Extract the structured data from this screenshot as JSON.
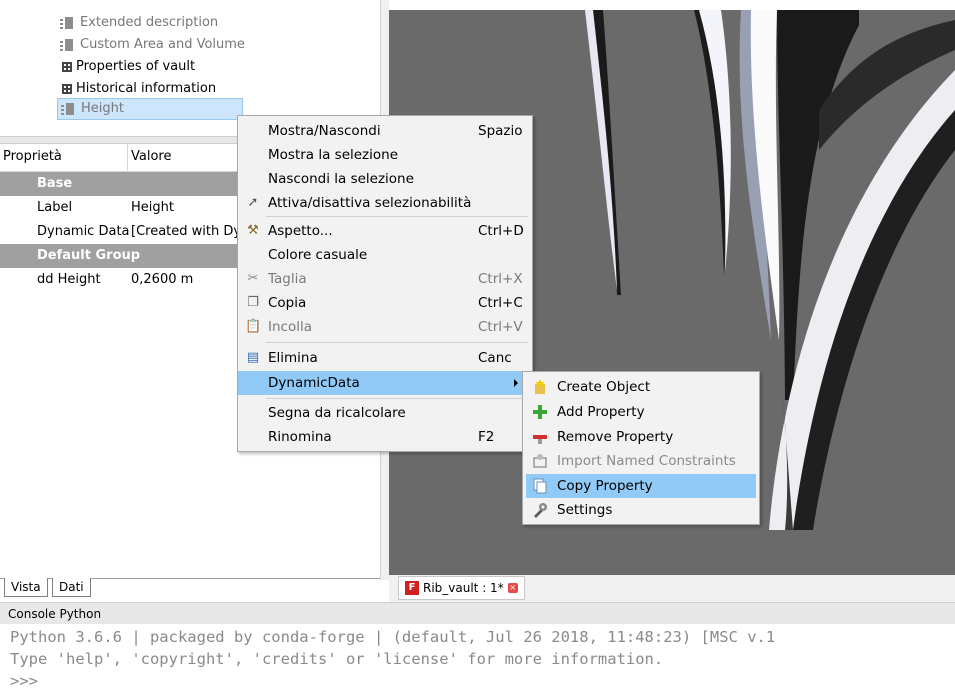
{
  "tree": {
    "items": [
      {
        "label": "Extended description",
        "icon": "document-icon",
        "greyed": true
      },
      {
        "label": "Custom Area and Volume",
        "icon": "document-icon",
        "greyed": true
      },
      {
        "label": "Properties of vault",
        "icon": "table-icon",
        "greyed": false
      },
      {
        "label": "Historical information",
        "icon": "table-icon",
        "greyed": false
      },
      {
        "label": "Height",
        "icon": "document-icon",
        "greyed": true,
        "selected": true
      }
    ]
  },
  "property_table": {
    "headers": [
      "Proprietà",
      "Valore"
    ],
    "rows": [
      {
        "type": "group",
        "name": "Base",
        "value": ""
      },
      {
        "type": "prop",
        "name": "Label",
        "value": "Height"
      },
      {
        "type": "prop",
        "name": "Dynamic Data",
        "value": "[Created with Dy"
      },
      {
        "type": "group",
        "name": "Default Group",
        "value": ""
      },
      {
        "type": "prop",
        "name": "dd Height",
        "value": "0,2600 m"
      }
    ]
  },
  "panel_tabs": [
    "Vista",
    "Dati"
  ],
  "context_menu": {
    "items": [
      {
        "label": "Mostra/Nascondi",
        "shortcut": "Spazio",
        "icon": "",
        "disabled": false
      },
      {
        "label": "Mostra la selezione",
        "shortcut": "",
        "icon": "",
        "disabled": false
      },
      {
        "label": "Nascondi la selezione",
        "shortcut": "",
        "icon": "",
        "disabled": false
      },
      {
        "label": "Attiva/disattiva selezionabilità",
        "shortcut": "",
        "icon": "cursor-arrow-icon",
        "disabled": false
      },
      {
        "label": "Aspetto...",
        "shortcut": "Ctrl+D",
        "icon": "brush-icon",
        "disabled": false
      },
      {
        "label": "Colore casuale",
        "shortcut": "",
        "icon": "",
        "disabled": false
      },
      {
        "label": "Taglia",
        "shortcut": "Ctrl+X",
        "icon": "scissors-icon",
        "disabled": true
      },
      {
        "label": "Copia",
        "shortcut": "Ctrl+C",
        "icon": "copy-icon",
        "disabled": false
      },
      {
        "label": "Incolla",
        "shortcut": "Ctrl+V",
        "icon": "paste-icon",
        "disabled": true
      },
      {
        "label": "Elimina",
        "shortcut": "Canc",
        "icon": "delete-icon",
        "disabled": false
      },
      {
        "label": "DynamicData",
        "shortcut": "",
        "icon": "",
        "disabled": false,
        "highlighted": true,
        "has_submenu": true
      },
      {
        "label": "Segna da ricalcolare",
        "shortcut": "",
        "icon": "",
        "disabled": false
      },
      {
        "label": "Rinomina",
        "shortcut": "F2",
        "icon": "",
        "disabled": false
      }
    ]
  },
  "submenu": {
    "items": [
      {
        "label": "Create Object",
        "icon": "create-object-icon",
        "disabled": false
      },
      {
        "label": "Add Property",
        "icon": "add-property-icon",
        "disabled": false
      },
      {
        "label": "Remove Property",
        "icon": "remove-property-icon",
        "disabled": false
      },
      {
        "label": "Import Named Constraints",
        "icon": "import-constraints-icon",
        "disabled": true
      },
      {
        "label": "Copy Property",
        "icon": "copy-property-icon",
        "disabled": false,
        "highlighted": true
      },
      {
        "label": "Settings",
        "icon": "settings-icon",
        "disabled": false
      }
    ]
  },
  "view_tab": {
    "label": "Rib_vault : 1*"
  },
  "console": {
    "title": "Console Python",
    "lines": [
      "Python 3.6.6 | packaged by conda-forge | (default, Jul 26 2018, 11:48:23) [MSC v.1",
      "Type 'help', 'copyright', 'credits' or 'license' for more information.",
      ">>>"
    ]
  },
  "colors": {
    "selection": "#91c9f7",
    "group_row": "#a0a0a0",
    "viewport_bg": "#6a6a6a"
  }
}
